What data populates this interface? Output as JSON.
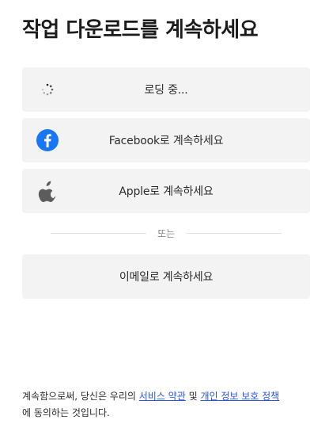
{
  "header": {
    "title": "작업 다운로드를 계속하세요"
  },
  "buttons": {
    "loading_label": "로딩 중...",
    "facebook_label": "Facebook로 계속하세요",
    "apple_label": "Apple로 계속하세요",
    "email_label": "이메일로 계속하세요"
  },
  "divider": {
    "text": "또는"
  },
  "terms": {
    "prefix": "계속함으로써, 당신은 우리의 ",
    "terms_link": "서비스 약관",
    "middle": " 및 ",
    "privacy_link": "개인 정보 보호 정책",
    "suffix": "에 동의하는 것입니다."
  },
  "colors": {
    "button_bg": "#f3f3f4",
    "facebook_blue": "#1877f2",
    "link_blue": "#2b57d9"
  },
  "icons": {
    "loading": "spinner-icon",
    "facebook": "facebook-icon",
    "apple": "apple-icon"
  }
}
